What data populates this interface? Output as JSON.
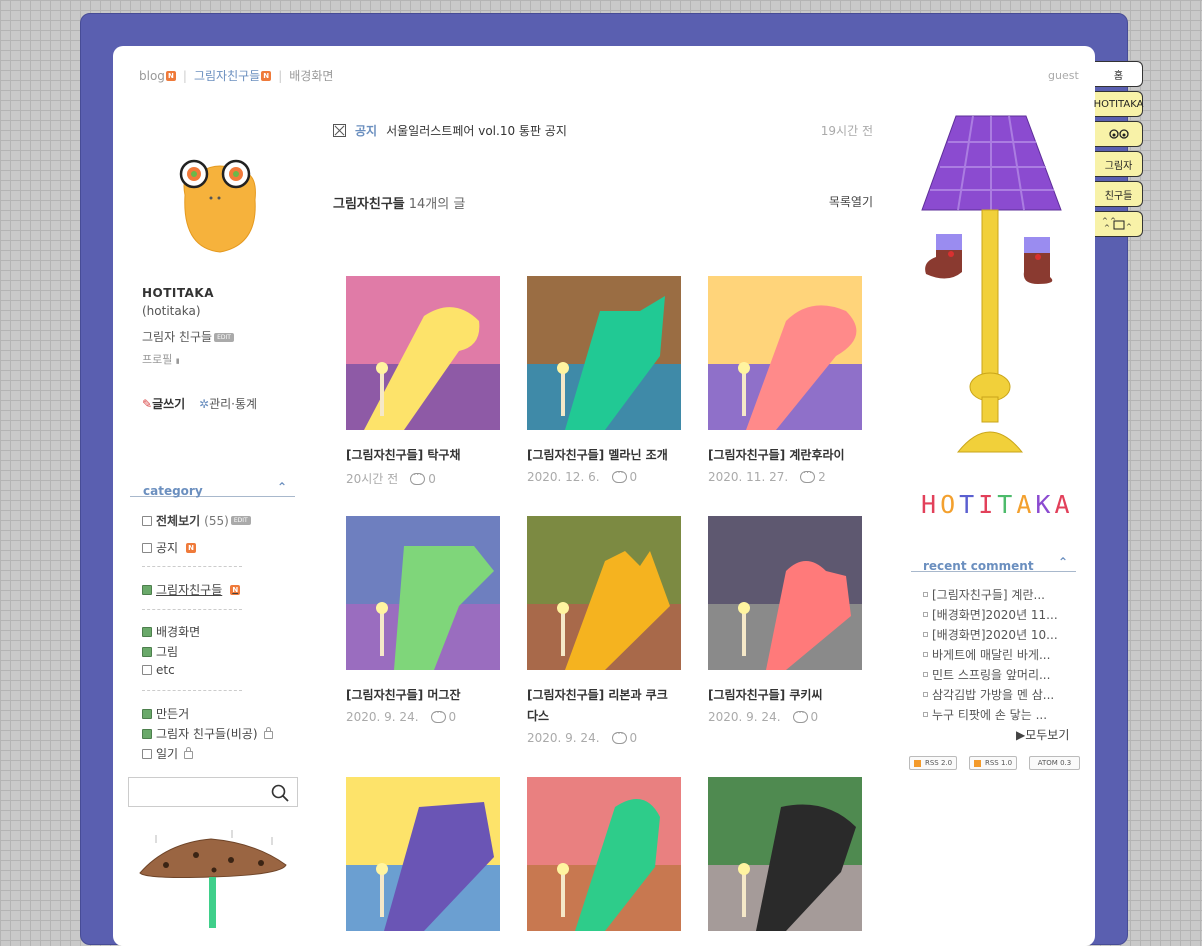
{
  "breadcrumb": {
    "blog": "blog",
    "current": "그림자친구들",
    "next": "배경화면",
    "badge": "N"
  },
  "user": {
    "guest": "guest"
  },
  "tabs": [
    "홈",
    "HOTITAKA",
    "ͦ ͦ",
    "그림자",
    "친구들",
    "ᓚᘏᗢ"
  ],
  "profile": {
    "name": "HOTITAKA",
    "handle": "(hotitaka)",
    "blog_desc": "그림자 친구들",
    "edit": "EDIT",
    "profile_link": "프로필",
    "write": "글쓰기",
    "admin": "관리·통계"
  },
  "category": {
    "title": "category",
    "all": "전체보기",
    "all_count": "(55)",
    "items": [
      "공지",
      "그림자친구들",
      "배경화면",
      "그림",
      "etc",
      "만든거",
      "그림자 친구들(비공)",
      "일기"
    ]
  },
  "notice": {
    "tag": "공지",
    "title": "서울일러스트페어 vol.10 통판 공지",
    "time": "19시간 전"
  },
  "list": {
    "title": "그림자친구들",
    "count": "14개의 글",
    "open": "목록열기"
  },
  "posts": [
    {
      "title": "[그림자친구들] 탁구채",
      "date": "20시간 전",
      "comments": "0"
    },
    {
      "title": "[그림자친구들] 멜라닌 조개",
      "date": "2020. 12. 6.",
      "comments": "0"
    },
    {
      "title": "[그림자친구들] 계란후라이",
      "date": "2020. 11. 27.",
      "comments": "2"
    },
    {
      "title": "[그림자친구들] 머그잔",
      "date": "2020. 9. 24.",
      "comments": "0"
    },
    {
      "title": "[그림자친구들] 리본과 쿠크다스",
      "date": "2020. 9. 24.",
      "comments": "0"
    },
    {
      "title": "[그림자친구들] 쿠키씨",
      "date": "2020. 9. 24.",
      "comments": "0"
    }
  ],
  "colors": {
    "frame": "#5a5fb0",
    "link": "#6b8fbf",
    "badge": "#ef7a3a",
    "thumbs": [
      [
        "#e07ba7",
        "#8e5aa6"
      ],
      [
        "#9a6d43",
        "#3f8aa8"
      ],
      [
        "#ffd47a",
        "#8f70c9"
      ],
      [
        "#6e7fbf",
        "#9a6dbf"
      ],
      [
        "#7c8a42",
        "#a8694a"
      ],
      [
        "#5e5870",
        "#8a8a8a"
      ],
      [
        "#fde36a",
        "#6b9fd1"
      ],
      [
        "#e98080",
        "#c87850"
      ],
      [
        "#4f8a50",
        "#a59b99"
      ]
    ],
    "shadows": [
      "#fde36a",
      "#21c994",
      "#ff8a8a",
      "#7fd67a",
      "#f5b31f",
      "#ff7a7a",
      "#6a55b5",
      "#2ecc8a",
      "#2a2a2a"
    ]
  },
  "logo_text": "HOTITAKA",
  "recent_comment": {
    "title": "recent comment",
    "items": [
      "[그림자친구들] 계란...",
      "[배경화면]2020년 11...",
      "[배경화면]2020년 10...",
      "바게트에 매달린 바게...",
      "민트 스프링을 앞머리...",
      "삼각김밥 가방을 멘 삼...",
      "누구 티팟에 손 닿는 ..."
    ],
    "more": "▶모두보기"
  },
  "feeds": [
    "RSS 2.0",
    "RSS 1.0",
    "ATOM 0.3"
  ]
}
